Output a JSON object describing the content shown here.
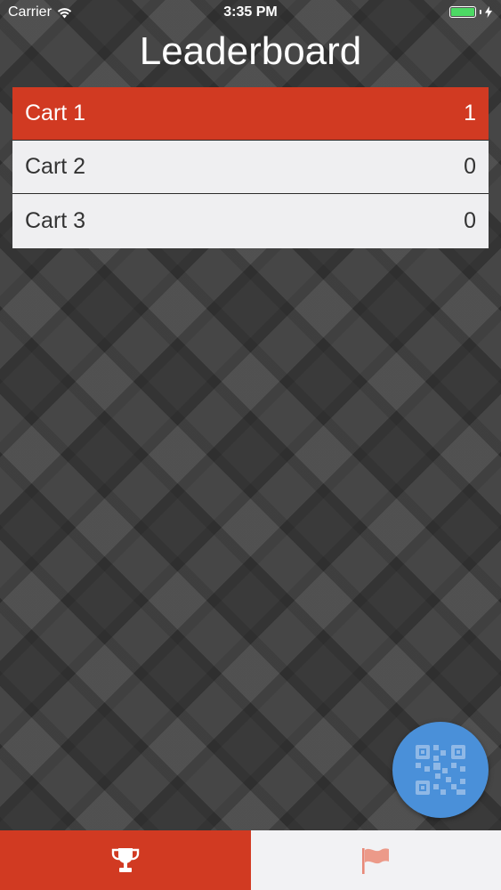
{
  "status_bar": {
    "carrier": "Carrier",
    "time": "3:35 PM"
  },
  "header": {
    "title": "Leaderboard"
  },
  "leaderboard": {
    "rows": [
      {
        "name": "Cart 1",
        "score": "1"
      },
      {
        "name": "Cart 2",
        "score": "0"
      },
      {
        "name": "Cart 3",
        "score": "0"
      }
    ]
  },
  "fab": {
    "icon": "qr-code-icon"
  },
  "tab_bar": {
    "tabs": [
      {
        "icon": "trophy-icon",
        "selected": true
      },
      {
        "icon": "flag-icon",
        "selected": false
      }
    ]
  },
  "colors": {
    "accent_red": "#d13a22",
    "fab_blue": "#4a90d9",
    "row_background": "#efeff1",
    "battery_green": "#4cd964"
  }
}
